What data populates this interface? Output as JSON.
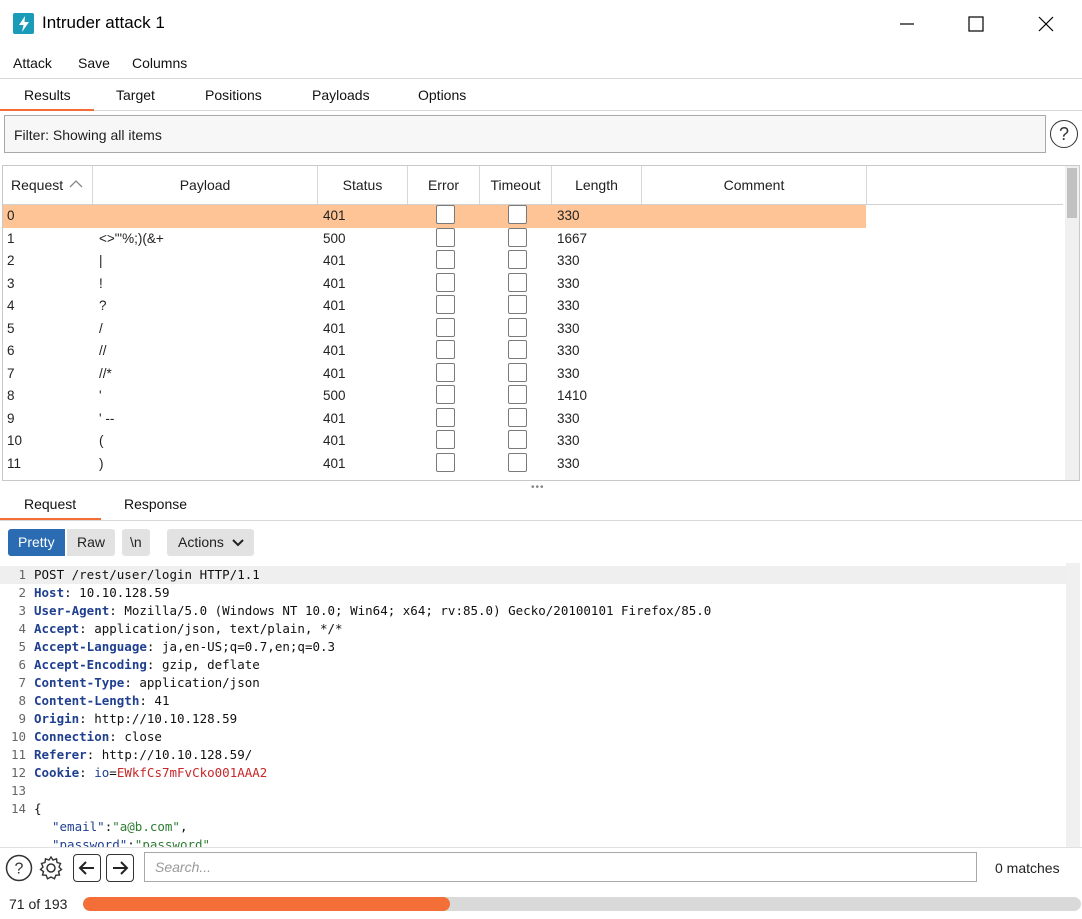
{
  "window": {
    "title": "Intruder attack 1"
  },
  "menu": [
    "Attack",
    "Save",
    "Columns"
  ],
  "tabs": [
    "Results",
    "Target",
    "Positions",
    "Payloads",
    "Options"
  ],
  "filter": {
    "text": "Filter: Showing all items"
  },
  "table": {
    "columns": [
      "Request",
      "Payload",
      "Status",
      "Error",
      "Timeout",
      "Length",
      "Comment"
    ],
    "rows": [
      {
        "request": "0",
        "payload": "",
        "status": "401",
        "length": "330"
      },
      {
        "request": "1",
        "payload": "<>\"'%;)(&+",
        "status": "500",
        "length": "1667"
      },
      {
        "request": "2",
        "payload": "|",
        "status": "401",
        "length": "330"
      },
      {
        "request": "3",
        "payload": "!",
        "status": "401",
        "length": "330"
      },
      {
        "request": "4",
        "payload": "?",
        "status": "401",
        "length": "330"
      },
      {
        "request": "5",
        "payload": "/",
        "status": "401",
        "length": "330"
      },
      {
        "request": "6",
        "payload": "//",
        "status": "401",
        "length": "330"
      },
      {
        "request": "7",
        "payload": "//*",
        "status": "401",
        "length": "330"
      },
      {
        "request": "8",
        "payload": "'",
        "status": "500",
        "length": "1410"
      },
      {
        "request": "9",
        "payload": "' --",
        "status": "401",
        "length": "330"
      },
      {
        "request": "10",
        "payload": "(",
        "status": "401",
        "length": "330"
      },
      {
        "request": "11",
        "payload": ")",
        "status": "401",
        "length": "330"
      }
    ],
    "selected_row": "0"
  },
  "request_tabs": [
    "Request",
    "Response"
  ],
  "editor_toolbar": {
    "pretty": "Pretty",
    "raw": "Raw",
    "newline": "\\n",
    "actions": "Actions"
  },
  "editor": {
    "line_numbers": [
      "1",
      "2",
      "3",
      "4",
      "5",
      "6",
      "7",
      "8",
      "9",
      "10",
      "11",
      "12",
      "13",
      "14"
    ],
    "request_line": "POST /rest/user/login HTTP/1.1",
    "headers": [
      {
        "name": "Host",
        "value": "10.10.128.59"
      },
      {
        "name": "User-Agent",
        "value": "Mozilla/5.0 (Windows NT 10.0; Win64; x64; rv:85.0) Gecko/20100101 Firefox/85.0"
      },
      {
        "name": "Accept",
        "value": "application/json, text/plain, */*"
      },
      {
        "name": "Accept-Language",
        "value": "ja,en-US;q=0.7,en;q=0.3"
      },
      {
        "name": "Accept-Encoding",
        "value": "gzip, deflate"
      },
      {
        "name": "Content-Type",
        "value": "application/json"
      },
      {
        "name": "Content-Length",
        "value": "41"
      },
      {
        "name": "Origin",
        "value": "http://10.10.128.59"
      },
      {
        "name": "Connection",
        "value": "close"
      },
      {
        "name": "Referer",
        "value": "http://10.10.128.59/"
      }
    ],
    "cookie": {
      "name": "Cookie",
      "key": "io",
      "value": "EWkfCs7mFvCko001AAA2"
    },
    "body_open": "{",
    "body_email_key": "\"email\"",
    "body_email_value": "\"a@b.com\"",
    "body_password_key": "\"password\"",
    "body_password_value": "\"password\""
  },
  "search": {
    "placeholder": "Search...",
    "matches": "0 matches"
  },
  "status": {
    "progress_text": "71 of 193",
    "progress_fraction": 0.368
  },
  "colors": {
    "accent": "#f36f37",
    "selected_row": "#ffc496",
    "pretty_active": "#2a6bb1",
    "app_icon": "#1a9bb8"
  }
}
